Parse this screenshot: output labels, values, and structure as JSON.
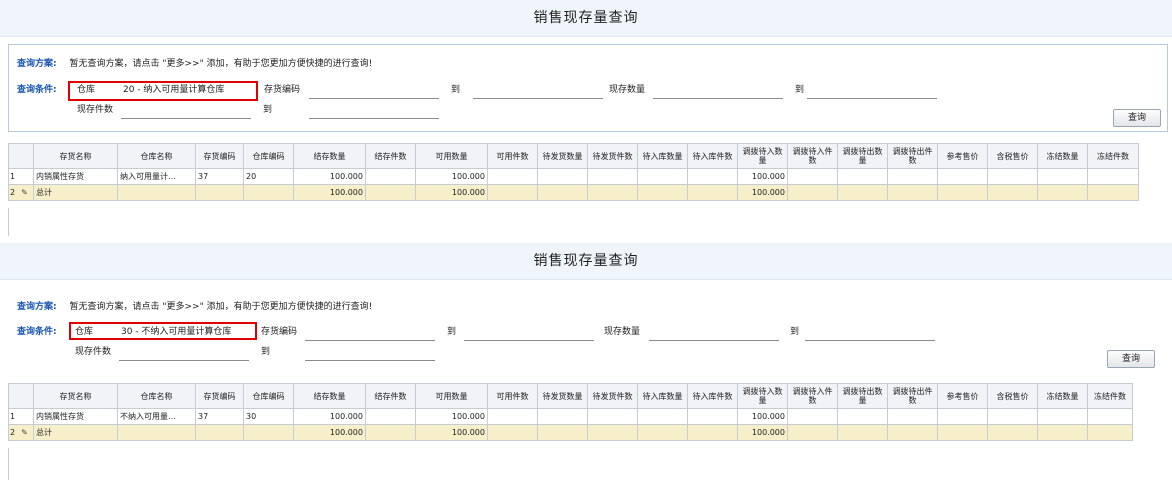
{
  "panels": [
    {
      "title": "销售现存量查询",
      "scheme_label": "查询方案:",
      "scheme_text": "暂无查询方案，请点击 \"更多>>\" 添加，有助于您更加方便快捷的进行查询!",
      "cond_label": "查询条件:",
      "warehouse_label": "仓库",
      "warehouse_value": "20 - 纳入可用量计算仓库",
      "inv_code_label": "存货编码",
      "to1": "到",
      "qty_label": "现存数量",
      "to2": "到",
      "pieces_label": "现存件数",
      "to3": "到",
      "query_button": "查询",
      "row1": [
        "1",
        "内销属性存货",
        "纳入可用量计…",
        "37",
        "20",
        "100.000",
        "",
        "100.000",
        "",
        "",
        "",
        "",
        "",
        "100.000",
        "",
        "",
        "",
        "",
        "",
        "",
        ""
      ],
      "total_row": [
        "2",
        "总计",
        "",
        "",
        "",
        "100.000",
        "",
        "100.000",
        "",
        "",
        "",
        "",
        "",
        "100.000",
        "",
        "",
        "",
        "",
        "",
        "",
        ""
      ]
    },
    {
      "title": "销售现存量查询",
      "scheme_label": "查询方案:",
      "scheme_text": "暂无查询方案，请点击 \"更多>>\" 添加，有助于您更加方便快捷的进行查询!",
      "cond_label": "查询条件:",
      "warehouse_label": "仓库",
      "warehouse_value": "30 - 不纳入可用量计算仓库",
      "inv_code_label": "存货编码",
      "to1": "到",
      "qty_label": "现存数量",
      "to2": "到",
      "pieces_label": "现存件数",
      "to3": "到",
      "query_button": "查询",
      "row1": [
        "1",
        "内销属性存货",
        "不纳入可用量…",
        "37",
        "30",
        "100.000",
        "",
        "100.000",
        "",
        "",
        "",
        "",
        "",
        "100.000",
        "",
        "",
        "",
        "",
        "",
        "",
        ""
      ],
      "total_row": [
        "2",
        "总计",
        "",
        "",
        "",
        "100.000",
        "",
        "100.000",
        "",
        "",
        "",
        "",
        "",
        "100.000",
        "",
        "",
        "",
        "",
        "",
        "",
        ""
      ]
    }
  ],
  "columns": [
    "",
    "存货名称",
    "仓库名称",
    "存货编码",
    "仓库编码",
    "结存数量",
    "结存件数",
    "可用数量",
    "可用件数",
    "待发货数量",
    "待发货件数",
    "待入库数量",
    "待入库件数",
    "调拨待入数量",
    "调拨待入件数",
    "调拨待出数量",
    "调拨待出件数",
    "参考售价",
    "含税售价",
    "冻结数量",
    "冻结件数"
  ],
  "colors": {
    "accent": "#1a56b0",
    "highlight": "#e00000",
    "total_bg": "#f7efc9"
  },
  "icons": {
    "pencil": "pencil-icon"
  }
}
